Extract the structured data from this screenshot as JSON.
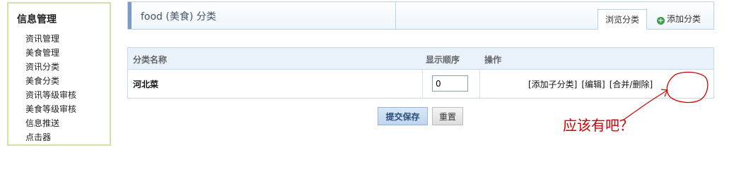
{
  "sidebar": {
    "title": "信息管理",
    "items": [
      {
        "label": "资讯管理"
      },
      {
        "label": "美食管理"
      },
      {
        "label": "资讯分类"
      },
      {
        "label": "美食分类"
      },
      {
        "label": "资讯等级审核"
      },
      {
        "label": "美食等级审核"
      },
      {
        "label": "信息推送"
      },
      {
        "label": "点击器"
      }
    ]
  },
  "header": {
    "title": "food (美食) 分类",
    "tabs": [
      {
        "label": "浏览分类"
      },
      {
        "label": "添加分类",
        "icon": "plus-circle-icon"
      }
    ]
  },
  "table": {
    "columns": [
      "分类名称",
      "显示顺序",
      "操作"
    ],
    "rows": [
      {
        "name": "河北菜",
        "order": "0",
        "actions": [
          "[添加子分类]",
          "[编辑]",
          "[合并/删除]"
        ]
      }
    ]
  },
  "buttons": {
    "submit": "提交保存",
    "reset": "重置"
  },
  "annotation": {
    "text": "应该有吧？",
    "color": "#d00000"
  }
}
